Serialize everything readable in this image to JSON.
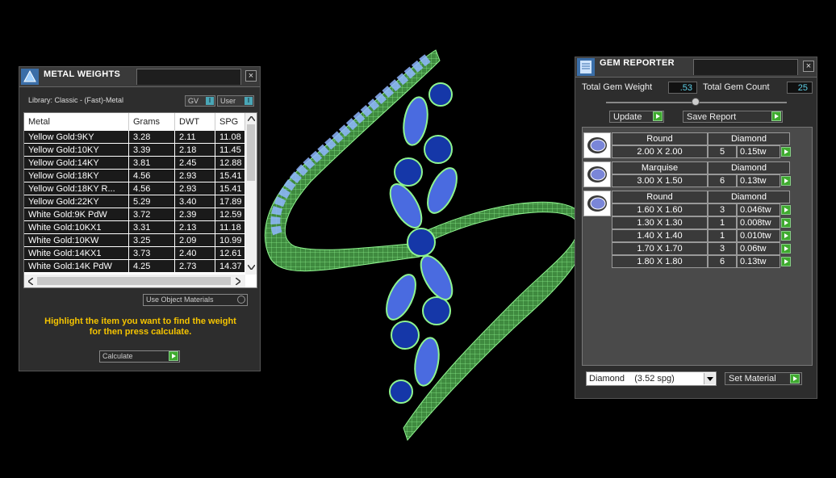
{
  "metal_weights": {
    "title": "METAL WEIGHTS",
    "library_label": "Library: Classic - (Fast)-Metal",
    "toggle_gv": "GV",
    "toggle_user": "User",
    "toggle_indicator": "I",
    "columns": [
      "Metal",
      "Grams",
      "DWT",
      "SPG"
    ],
    "rows": [
      [
        "Yellow Gold:9KY",
        "3.28",
        "2.11",
        "11.08"
      ],
      [
        "Yellow Gold:10KY",
        "3.39",
        "2.18",
        "11.45"
      ],
      [
        "Yellow Gold:14KY",
        "3.81",
        "2.45",
        "12.88"
      ],
      [
        "Yellow Gold:18KY",
        "4.56",
        "2.93",
        "15.41"
      ],
      [
        "Yellow Gold:18KY R...",
        "4.56",
        "2.93",
        "15.41"
      ],
      [
        "Yellow Gold:22KY",
        "5.29",
        "3.40",
        "17.89"
      ],
      [
        "White Gold:9K PdW",
        "3.72",
        "2.39",
        "12.59"
      ],
      [
        "White Gold:10KX1",
        "3.31",
        "2.13",
        "11.18"
      ],
      [
        "White Gold:10KW",
        "3.25",
        "2.09",
        "10.99"
      ],
      [
        "White Gold:14KX1",
        "3.73",
        "2.40",
        "12.61"
      ],
      [
        "White Gold:14K PdW",
        "4.25",
        "2.73",
        "14.37"
      ]
    ],
    "use_object_materials": "Use Object Materials",
    "hint_line1": "Highlight the item you want to find the weight",
    "hint_line2": "for then press calculate.",
    "calculate_label": "Calculate"
  },
  "gem_reporter": {
    "title": "GEM REPORTER",
    "total_weight_label": "Total Gem Weight",
    "total_weight_value": ".53",
    "total_count_label": "Total Gem Count",
    "total_count_value": "25",
    "update_label": "Update",
    "save_report_label": "Save Report",
    "groups": [
      {
        "shape": "Round",
        "material": "Diamond",
        "rows": [
          [
            "2.00 X 2.00",
            "5",
            "0.15tw"
          ]
        ]
      },
      {
        "shape": "Marquise",
        "material": "Diamond",
        "rows": [
          [
            "3.00 X 1.50",
            "6",
            "0.13tw"
          ]
        ]
      },
      {
        "shape": "Round",
        "material": "Diamond",
        "rows": [
          [
            "1.60 X 1.60",
            "3",
            "0.046tw"
          ],
          [
            "1.30 X 1.30",
            "1",
            "0.008tw"
          ],
          [
            "1.40 X 1.40",
            "1",
            "0.010tw"
          ],
          [
            "1.70 X 1.70",
            "3",
            "0.06tw"
          ],
          [
            "1.80 X 1.80",
            "6",
            "0.13tw"
          ]
        ]
      }
    ],
    "material_select": "Diamond    (3.52 spg)",
    "set_material_label": "Set Material"
  },
  "colors": {
    "wire_green": "#7df07d",
    "gem_blue": "#3a5ad8",
    "gem_dark": "#1537a8",
    "hint_yellow": "#f5c400",
    "value_cyan": "#5fd0e8"
  }
}
